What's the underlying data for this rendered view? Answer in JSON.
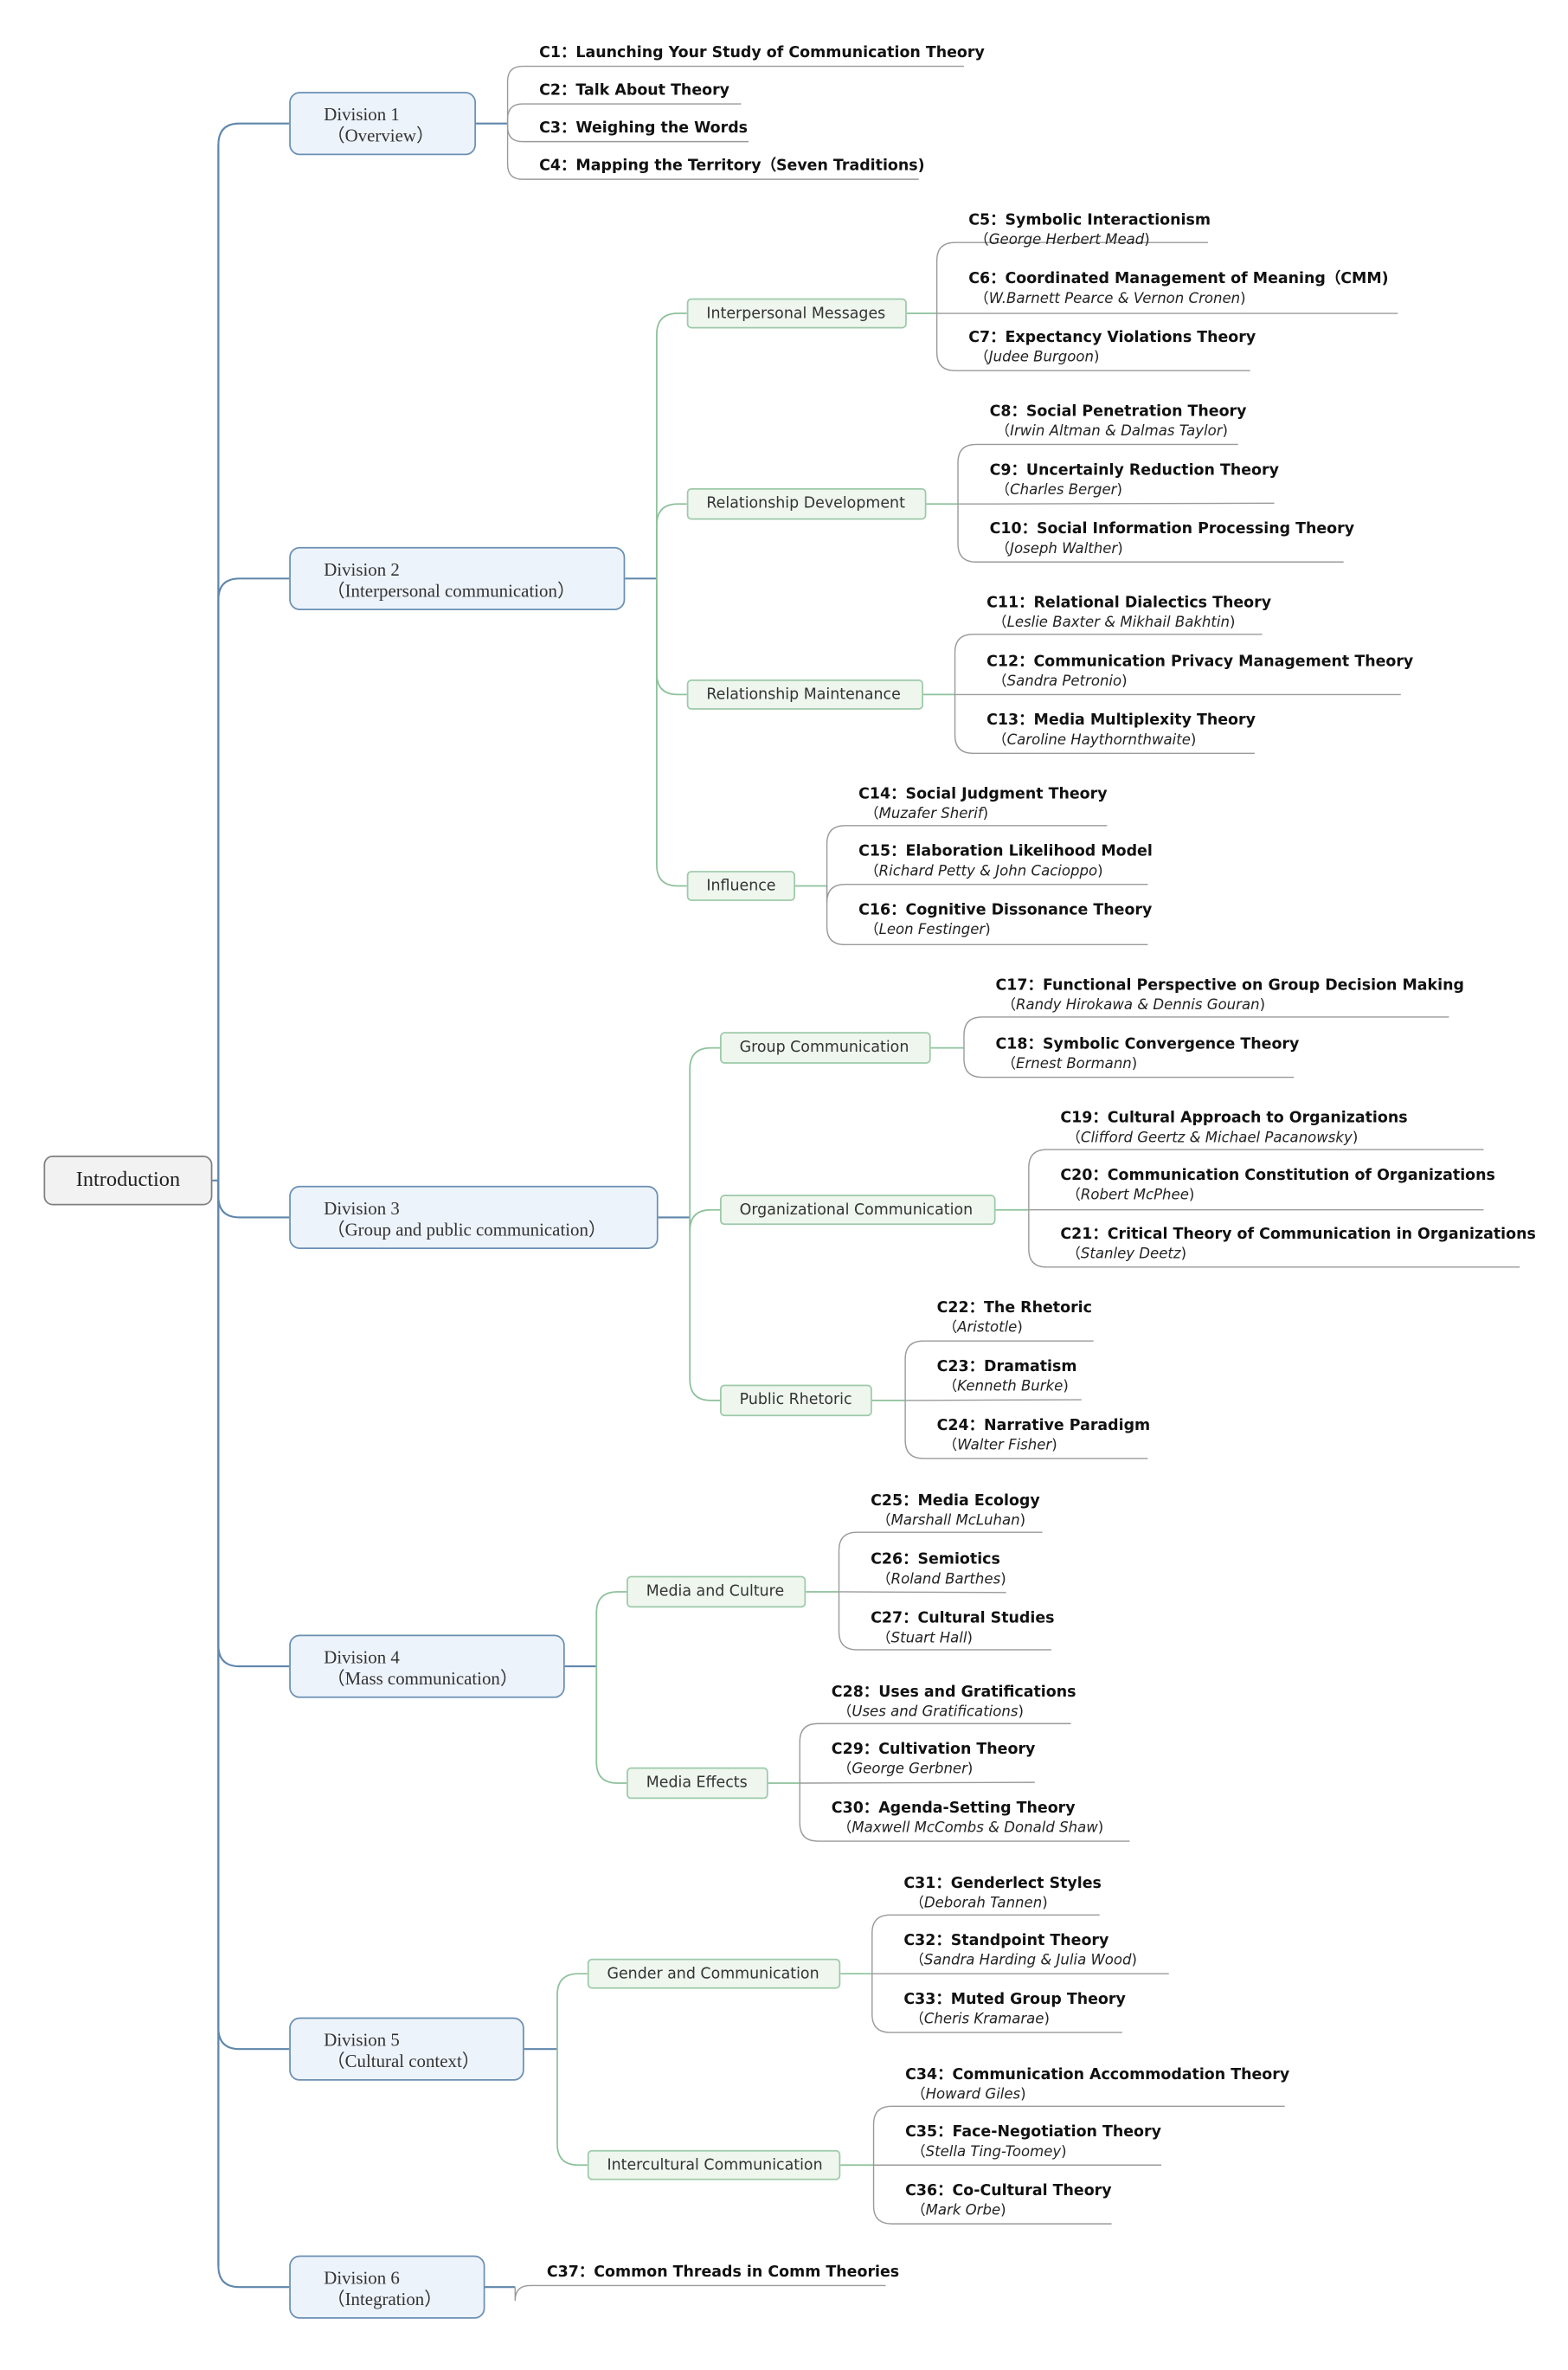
{
  "root": {
    "label": "Introduction"
  },
  "colors": {
    "main_line": "#5f86ab",
    "topic_line": "#8dc19b",
    "leaf_line": "#9a9a9a"
  },
  "divisions": [
    {
      "name": "Division 1",
      "subtitle": "（Overview）",
      "chapters": [
        {
          "title": "C1：Launching Your Study of Communication Theory"
        },
        {
          "title": "C2：Talk About Theory"
        },
        {
          "title": "C3：Weighing the Words"
        },
        {
          "title": "C4：Mapping the Territory（Seven Traditions)"
        }
      ]
    },
    {
      "name": "Division 2",
      "subtitle": "（Interpersonal communication）",
      "topics": [
        {
          "label": "Interpersonal Messages",
          "chapters": [
            {
              "title": "C5：Symbolic Interactionism",
              "author": "George Herbert Mead"
            },
            {
              "title": "C6：Coordinated Management of Meaning（CMM)",
              "author": "W.Barnett Pearce & Vernon Cronen"
            },
            {
              "title": "C7：Expectancy Violations Theory",
              "author": "Judee Burgoon"
            }
          ]
        },
        {
          "label": "Relationship Development",
          "chapters": [
            {
              "title": "C8：Social Penetration Theory",
              "author": "Irwin Altman & Dalmas Taylor"
            },
            {
              "title": "C9：Uncertainly Reduction Theory",
              "author": "Charles Berger"
            },
            {
              "title": "C10：Social Information Processing Theory",
              "author": "Joseph Walther"
            }
          ]
        },
        {
          "label": "Relationship Maintenance",
          "chapters": [
            {
              "title": "C11：Relational Dialectics Theory",
              "author": "Leslie Baxter & Mikhail Bakhtin"
            },
            {
              "title": "C12：Communication Privacy Management Theory",
              "author": "Sandra Petronio"
            },
            {
              "title": "C13：Media Multiplexity Theory",
              "author": "Caroline Haythornthwaite"
            }
          ]
        },
        {
          "label": "Influence",
          "chapters": [
            {
              "title": "C14：Social Judgment Theory",
              "author": "Muzafer Sherif"
            },
            {
              "title": "C15：Elaboration Likelihood Model",
              "author": "Richard Petty & John Cacioppo"
            },
            {
              "title": "C16：Cognitive Dissonance Theory",
              "author": "Leon Festinger"
            }
          ]
        }
      ]
    },
    {
      "name": "Division 3",
      "subtitle": "（Group and public communication）",
      "topics": [
        {
          "label": "Group Communication",
          "chapters": [
            {
              "title": "C17：Functional Perspective on Group Decision Making",
              "author": "Randy Hirokawa & Dennis Gouran"
            },
            {
              "title": "C18：Symbolic Convergence Theory",
              "author": "Ernest Bormann"
            }
          ]
        },
        {
          "label": "Organizational Communication",
          "chapters": [
            {
              "title": "C19：Cultural Approach to Organizations",
              "author": "Clifford Geertz & Michael Pacanowsky"
            },
            {
              "title": "C20：Communication Constitution of Organizations",
              "author": "Robert McPhee"
            },
            {
              "title": "C21：Critical Theory of Communication in Organizations",
              "author": "Stanley Deetz"
            }
          ]
        },
        {
          "label": "Public Rhetoric",
          "chapters": [
            {
              "title": "C22：The Rhetoric",
              "author": "Aristotle"
            },
            {
              "title": "C23：Dramatism",
              "author": "Kenneth Burke"
            },
            {
              "title": "C24：Narrative Paradigm",
              "author": "Walter Fisher"
            }
          ]
        }
      ]
    },
    {
      "name": "Division 4",
      "subtitle": "（Mass communication）",
      "topics": [
        {
          "label": "Media and Culture",
          "chapters": [
            {
              "title": "C25：Media Ecology",
              "author": "Marshall McLuhan"
            },
            {
              "title": "C26：Semiotics",
              "author": "Roland Barthes"
            },
            {
              "title": "C27：Cultural Studies",
              "author": "Stuart Hall"
            }
          ]
        },
        {
          "label": "Media Effects",
          "chapters": [
            {
              "title": "C28：Uses and Gratifications",
              "author": "Uses and Gratifications"
            },
            {
              "title": "C29：Cultivation Theory",
              "author": "George Gerbner"
            },
            {
              "title": "C30：Agenda-Setting Theory",
              "author": "Maxwell McCombs & Donald Shaw"
            }
          ]
        }
      ]
    },
    {
      "name": "Division 5",
      "subtitle": "（Cultural context）",
      "topics": [
        {
          "label": "Gender and Communication",
          "chapters": [
            {
              "title": "C31：Genderlect Styles",
              "author": "Deborah Tannen"
            },
            {
              "title": "C32：Standpoint Theory",
              "author": "Sandra Harding & Julia Wood"
            },
            {
              "title": "C33：Muted Group Theory",
              "author": "Cheris Kramarae"
            }
          ]
        },
        {
          "label": "Intercultural Communication",
          "chapters": [
            {
              "title": "C34：Communication Accommodation Theory",
              "author": "Howard Giles"
            },
            {
              "title": "C35：Face-Negotiation Theory",
              "author": "Stella Ting-Toomey"
            },
            {
              "title": "C36：Co-Cultural Theory",
              "author": "Mark Orbe"
            }
          ]
        }
      ]
    },
    {
      "name": "Division 6",
      "subtitle": "（Integration）",
      "chapters": [
        {
          "title": "C37：Common Threads in Comm Theories"
        }
      ]
    }
  ]
}
